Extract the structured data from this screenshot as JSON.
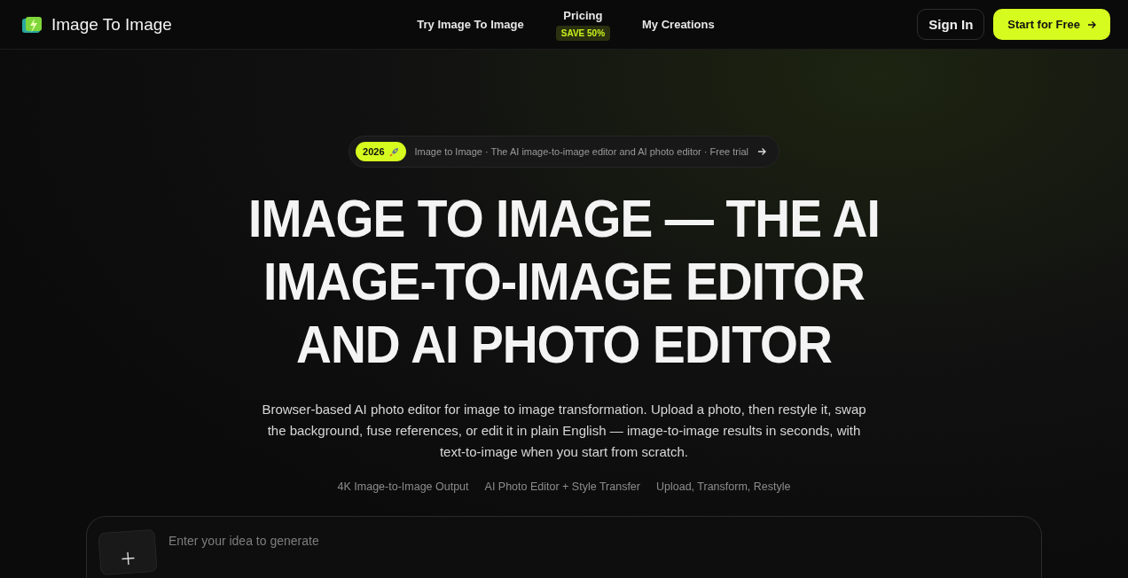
{
  "header": {
    "brand": "Image To Image",
    "nav": [
      {
        "label": "Try Image To Image"
      },
      {
        "label": "Pricing",
        "badge": "SAVE 50%"
      },
      {
        "label": "My Creations"
      }
    ],
    "sign_in": "Sign In",
    "cta": "Start for Free"
  },
  "hero": {
    "announcement": {
      "badge": "2026",
      "text": "Image to Image · The AI image-to-image editor and AI photo editor · Free trial"
    },
    "title": "IMAGE TO IMAGE — THE AI IMAGE-TO-IMAGE EDITOR AND AI PHOTO EDITOR",
    "description": "Browser-based AI photo editor for image to image transformation. Upload a photo, then restyle it, swap the background, fuse references, or edit it in plain English — image-to-image results in seconds, with text-to-image when you start from scratch.",
    "features": [
      "4K Image-to-Image Output",
      "AI Photo Editor + Style Transfer",
      "Upload, Transform, Restyle"
    ]
  },
  "prompt": {
    "placeholder": "Enter your idea to generate"
  }
}
